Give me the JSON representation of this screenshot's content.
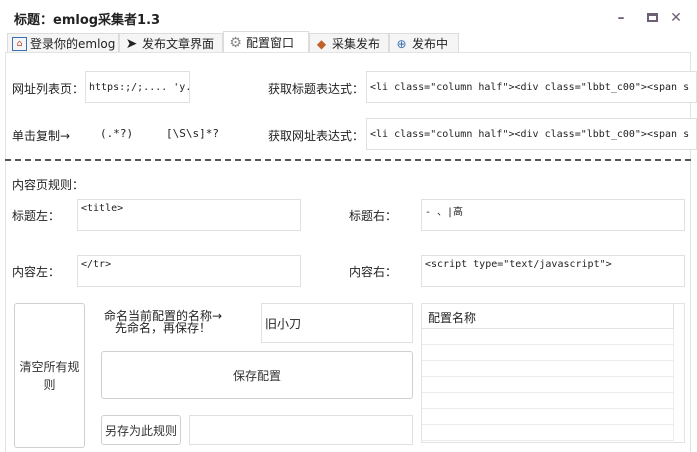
{
  "window": {
    "title": "标题：emlog采集者1.3",
    "minimize": "–",
    "maximize": "▭",
    "close": "✕",
    "accent": "#6e5f77"
  },
  "tabs": [
    {
      "label": "登录你的emlog",
      "icon": "home-icon"
    },
    {
      "label": "发布文章界面",
      "icon": "send-icon"
    },
    {
      "label": "配置窗口",
      "icon": "gear-icon",
      "active": true
    },
    {
      "label": "采集发布",
      "icon": "gem-icon"
    },
    {
      "label": "发布中",
      "icon": "plus-circle-icon"
    }
  ],
  "list": {
    "url_label": "网址列表页：",
    "url_value": "https:;/;....         'y.com",
    "title_expr_label": "获取标题表达式：",
    "title_expr_value": "<li class=\"column half\"><div class=\"lbbt_c00\"><span s",
    "copy_label": "单击复制→",
    "copy_token1": "(.*?)",
    "copy_token2": "[\\S\\s]*?",
    "url_expr_label": "获取网址表达式：",
    "url_expr_value": "<li class=\"column half\"><div class=\"lbbt_c00\"><span s"
  },
  "content": {
    "section_label": "内容页规则：",
    "title_left_label": "标题左：",
    "title_left_value": "<title>",
    "title_right_label": "标题右：",
    "title_right_value": "- 、|高",
    "content_left_label": "内容左：",
    "content_left_value": "</tr>",
    "content_right_label": "内容右：",
    "content_right_value": "<script type=\"text/javascript\">"
  },
  "config": {
    "clear_button": "清空所有规则",
    "name_hint_line1": "命名当前配置的名称→",
    "name_hint_line2": "先命名，再保存！",
    "name_value": "旧小刀",
    "save_button": "保存配置",
    "save_as_button": "另存为此规则",
    "save_as_value": "",
    "table_header": "配置名称"
  }
}
